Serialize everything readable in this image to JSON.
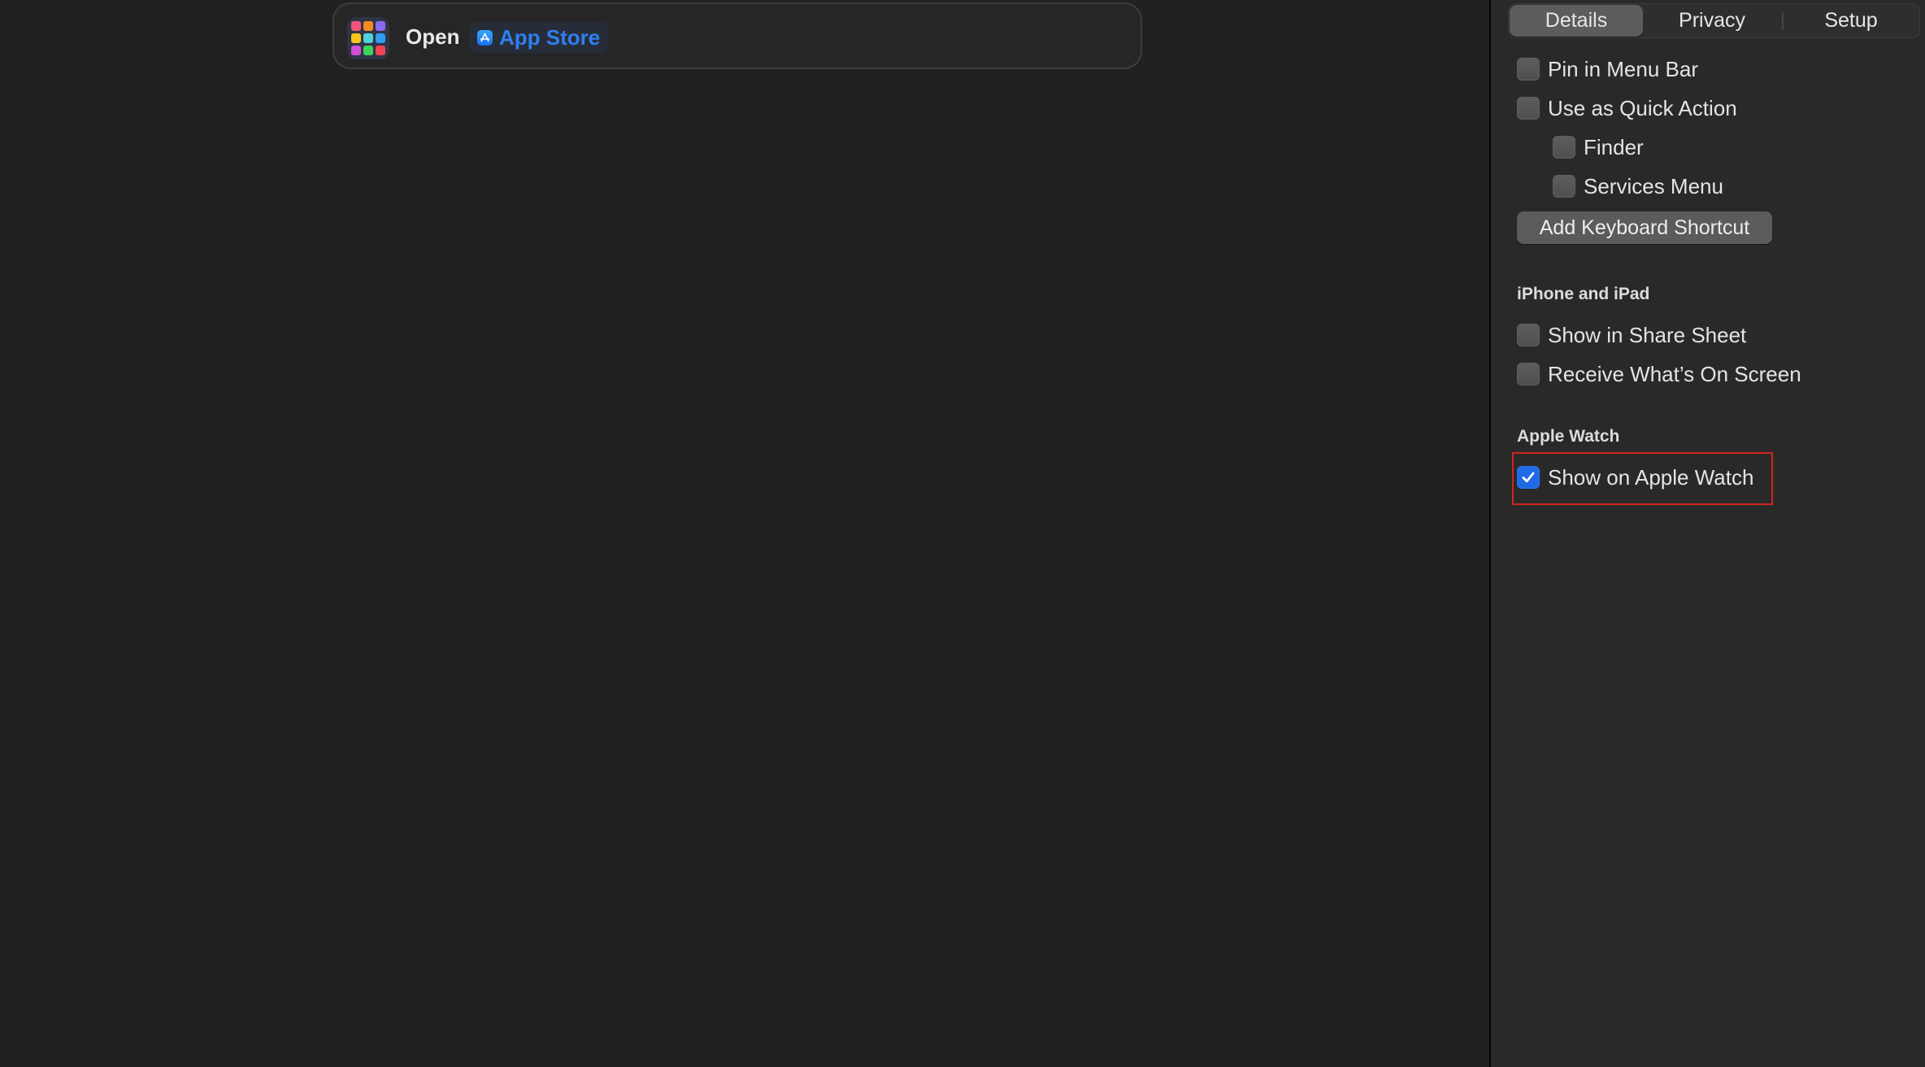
{
  "editor": {
    "action": {
      "icon": "apps-grid-icon",
      "icon_colors": [
        "#f2557b",
        "#f68b1f",
        "#8a6cf0",
        "#f8c51c",
        "#4fd2dc",
        "#2f9cf4",
        "#d34fd8",
        "#3ed45a",
        "#f2434f"
      ],
      "verb": "Open",
      "app": {
        "icon": "app-store-icon",
        "label": "App Store",
        "color": "#2f7ff0"
      }
    }
  },
  "inspector": {
    "tabs": [
      {
        "label": "Details",
        "selected": true
      },
      {
        "label": "Privacy",
        "selected": false
      },
      {
        "label": "Setup",
        "selected": false
      }
    ],
    "options": {
      "pin_in_menu_bar": {
        "label": "Pin in Menu Bar",
        "checked": false
      },
      "use_as_quick_action": {
        "label": "Use as Quick Action",
        "checked": false
      },
      "finder": {
        "label": "Finder",
        "checked": false
      },
      "services_menu": {
        "label": "Services Menu",
        "checked": false
      }
    },
    "add_shortcut_label": "Add Keyboard Shortcut",
    "iphone_section": {
      "heading": "iPhone and iPad",
      "show_in_share_sheet": {
        "label": "Show in Share Sheet",
        "checked": false
      },
      "receive_on_screen": {
        "label": "Receive What’s On Screen",
        "checked": false
      }
    },
    "watch_section": {
      "heading": "Apple Watch",
      "show_on_apple_watch": {
        "label": "Show on Apple Watch",
        "checked": true
      }
    },
    "accent_color": "#1f6ae6",
    "highlight_color": "#d0261c"
  }
}
